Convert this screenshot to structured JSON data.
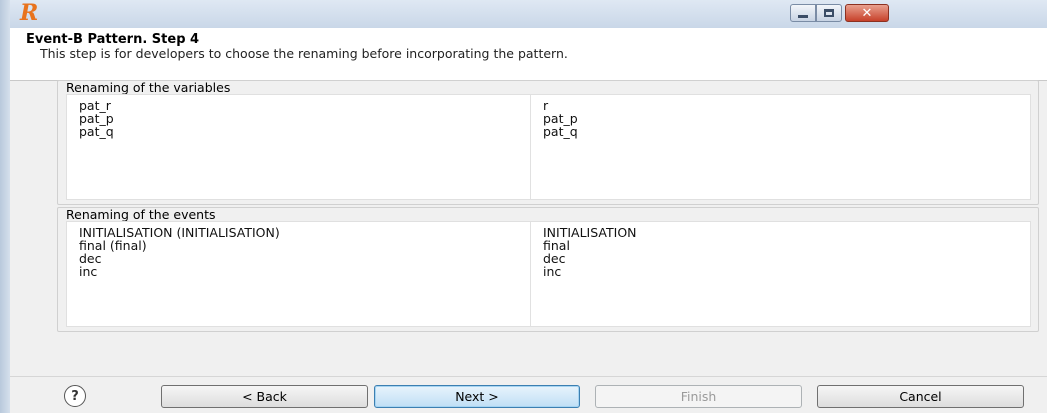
{
  "window": {
    "logo_glyph": "R",
    "min_icon": "minimize-icon",
    "max_icon": "maximize-icon",
    "close_icon": "close-icon",
    "close_glyph": "✕"
  },
  "header": {
    "title": "Event-B Pattern. Step 4",
    "description": "This step is for developers to choose the renaming before incorporating the pattern."
  },
  "variables": {
    "label": "Renaming of the variables",
    "rows": [
      {
        "from": "pat_r",
        "to": "r"
      },
      {
        "from": "pat_p",
        "to": "pat_p"
      },
      {
        "from": "pat_q",
        "to": "pat_q"
      }
    ]
  },
  "events": {
    "label": "Renaming of the events",
    "rows": [
      {
        "from": "INITIALISATION (INITIALISATION)",
        "to": "INITIALISATION"
      },
      {
        "from": "final (final)",
        "to": "final"
      },
      {
        "from": "dec",
        "to": "dec"
      },
      {
        "from": "inc",
        "to": "inc"
      }
    ]
  },
  "buttons": {
    "help_glyph": "?",
    "back": "< Back",
    "next": "Next >",
    "finish": "Finish",
    "cancel": "Cancel"
  },
  "colors": {
    "logo": "#e8731d",
    "close_button": "#c7412a",
    "next_border": "#3c7fb1",
    "disabled_text": "#9a9a9a"
  }
}
